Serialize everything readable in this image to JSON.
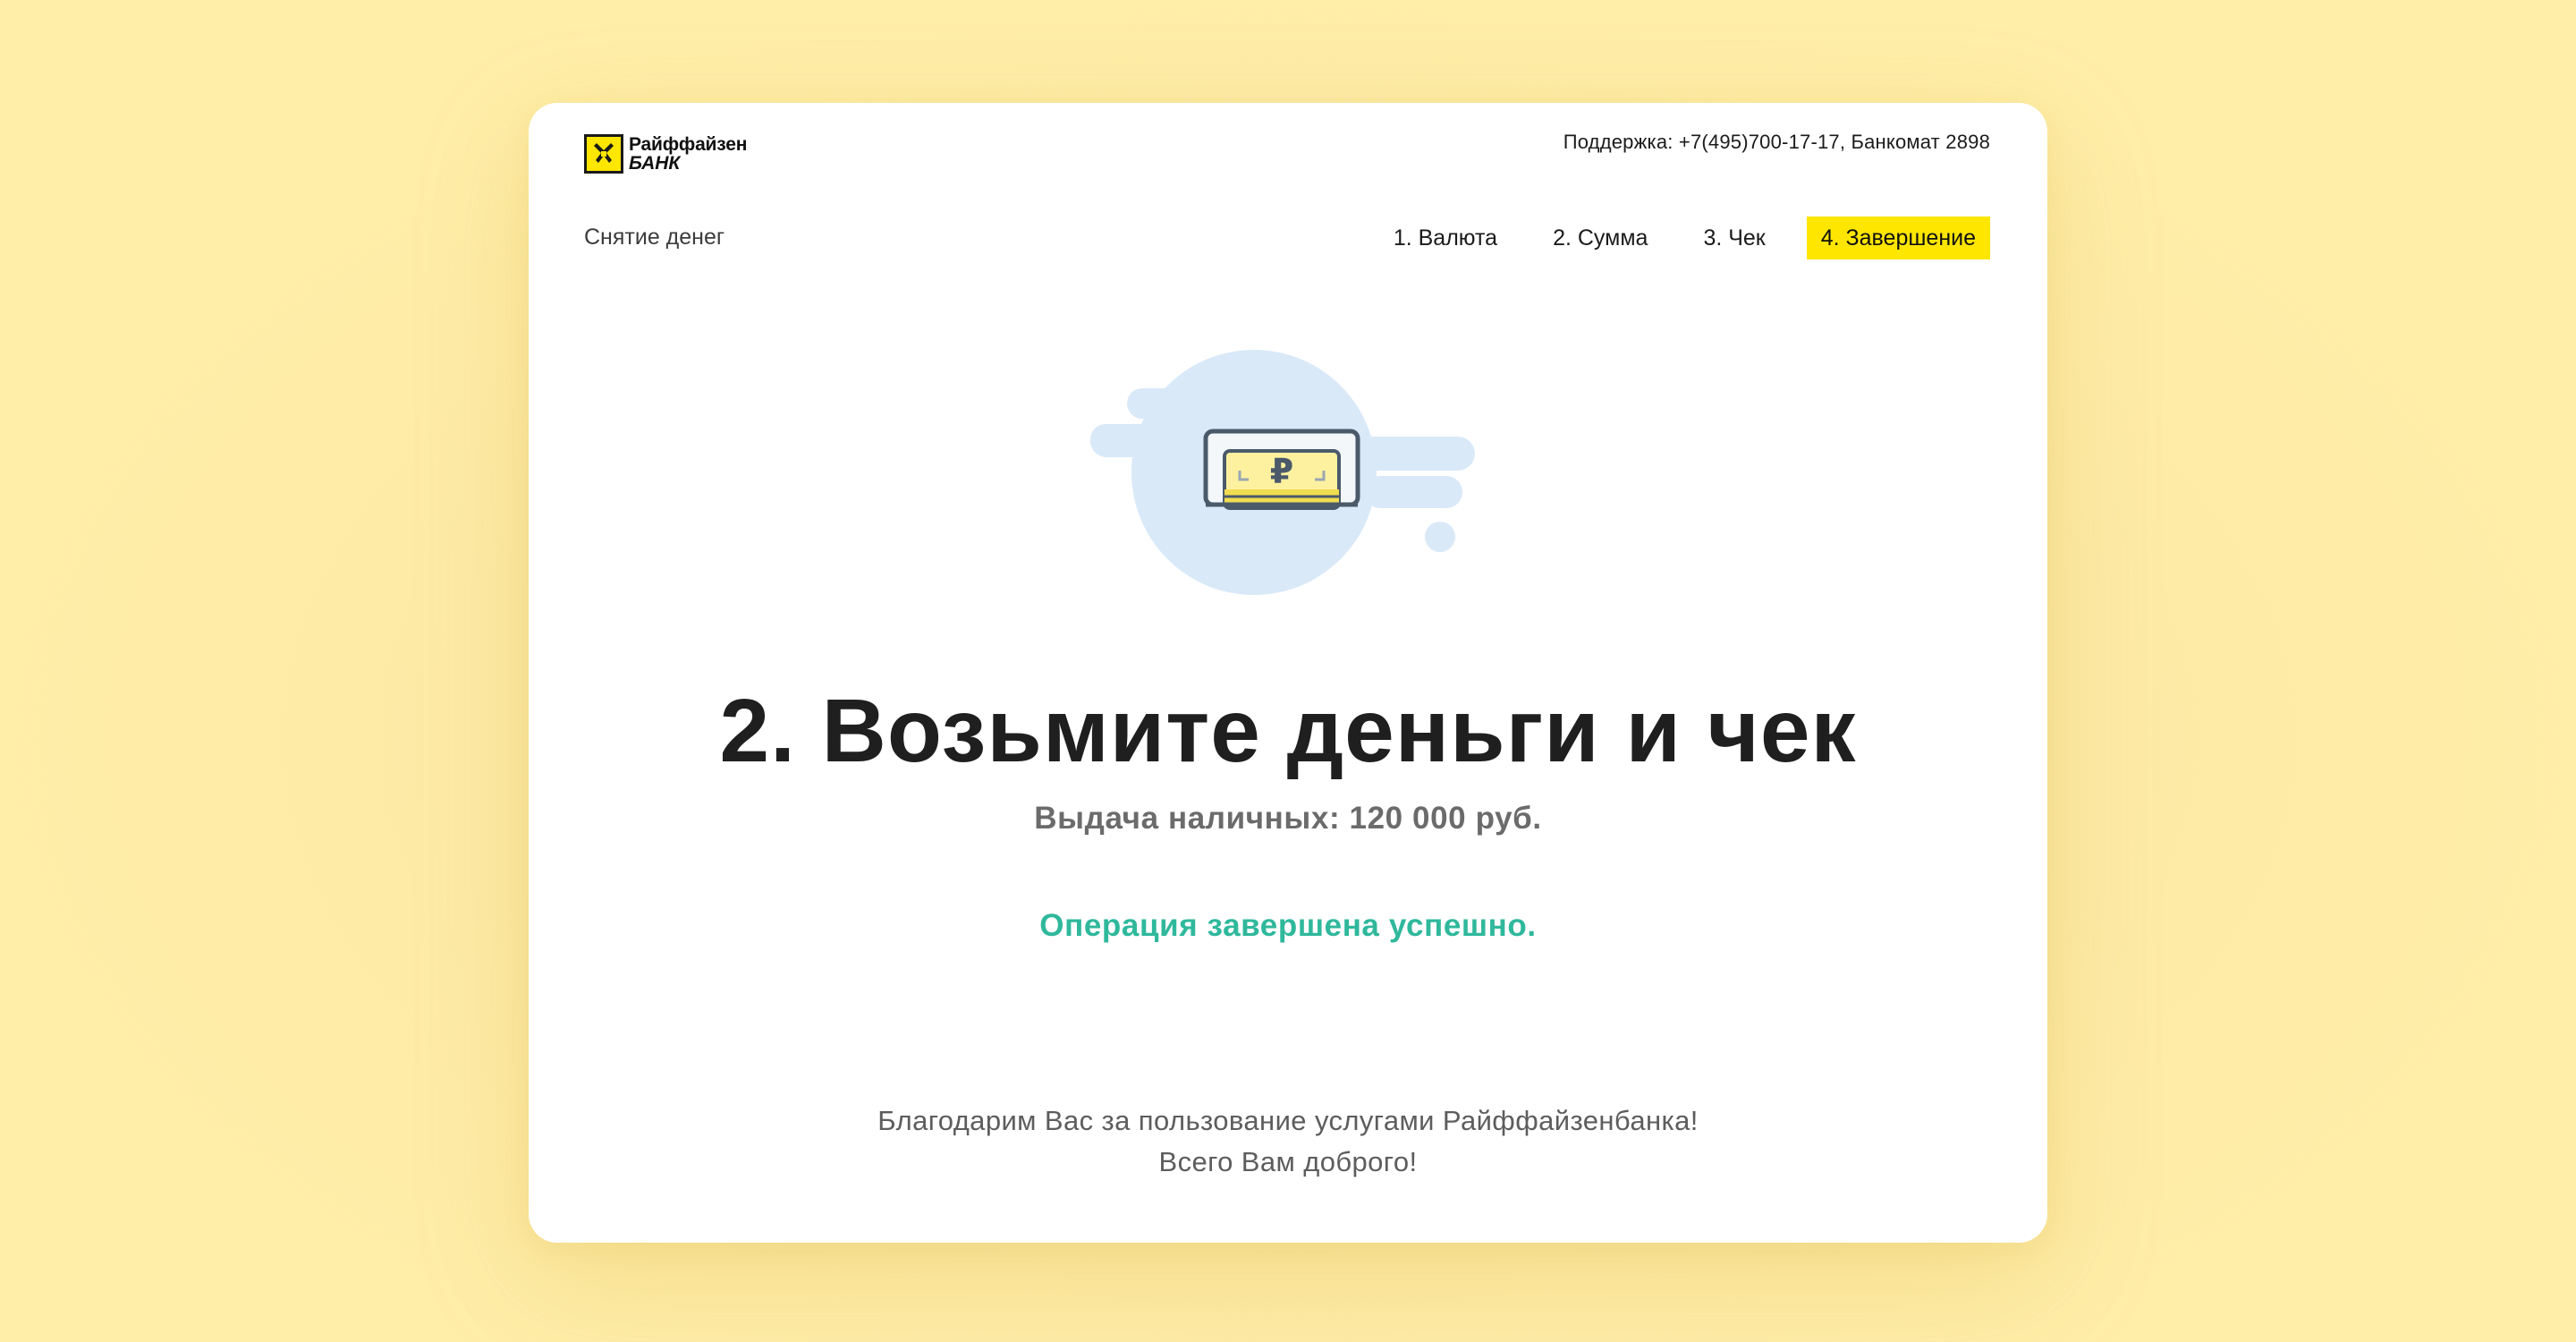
{
  "brand": {
    "line1": "Райффайзен",
    "line2": "БАНК",
    "accent_color": "#fee600"
  },
  "header": {
    "support": "Поддержка: +7(495)700-17-17, Банкомат 2898"
  },
  "nav": {
    "section_title": "Снятие денег",
    "steps": [
      {
        "label": "1. Валюта",
        "active": false
      },
      {
        "label": "2. Сумма",
        "active": false
      },
      {
        "label": "3. Чек",
        "active": false
      },
      {
        "label": "4. Завершение",
        "active": true
      }
    ]
  },
  "illustration": {
    "icon": "cash-dispenser-icon",
    "currency_symbol": "₽"
  },
  "main": {
    "headline": "2. Возьмите деньги и чек",
    "amount_text": "Выдача наличных: 120 000 руб.",
    "status_text": "Операция завершена успешно.",
    "status_color": "#2fb89c"
  },
  "footer": {
    "thanks_line1": "Благодарим Вас за пользование услугами Райффайзенбанка!",
    "thanks_line2": "Всего Вам доброго!"
  }
}
